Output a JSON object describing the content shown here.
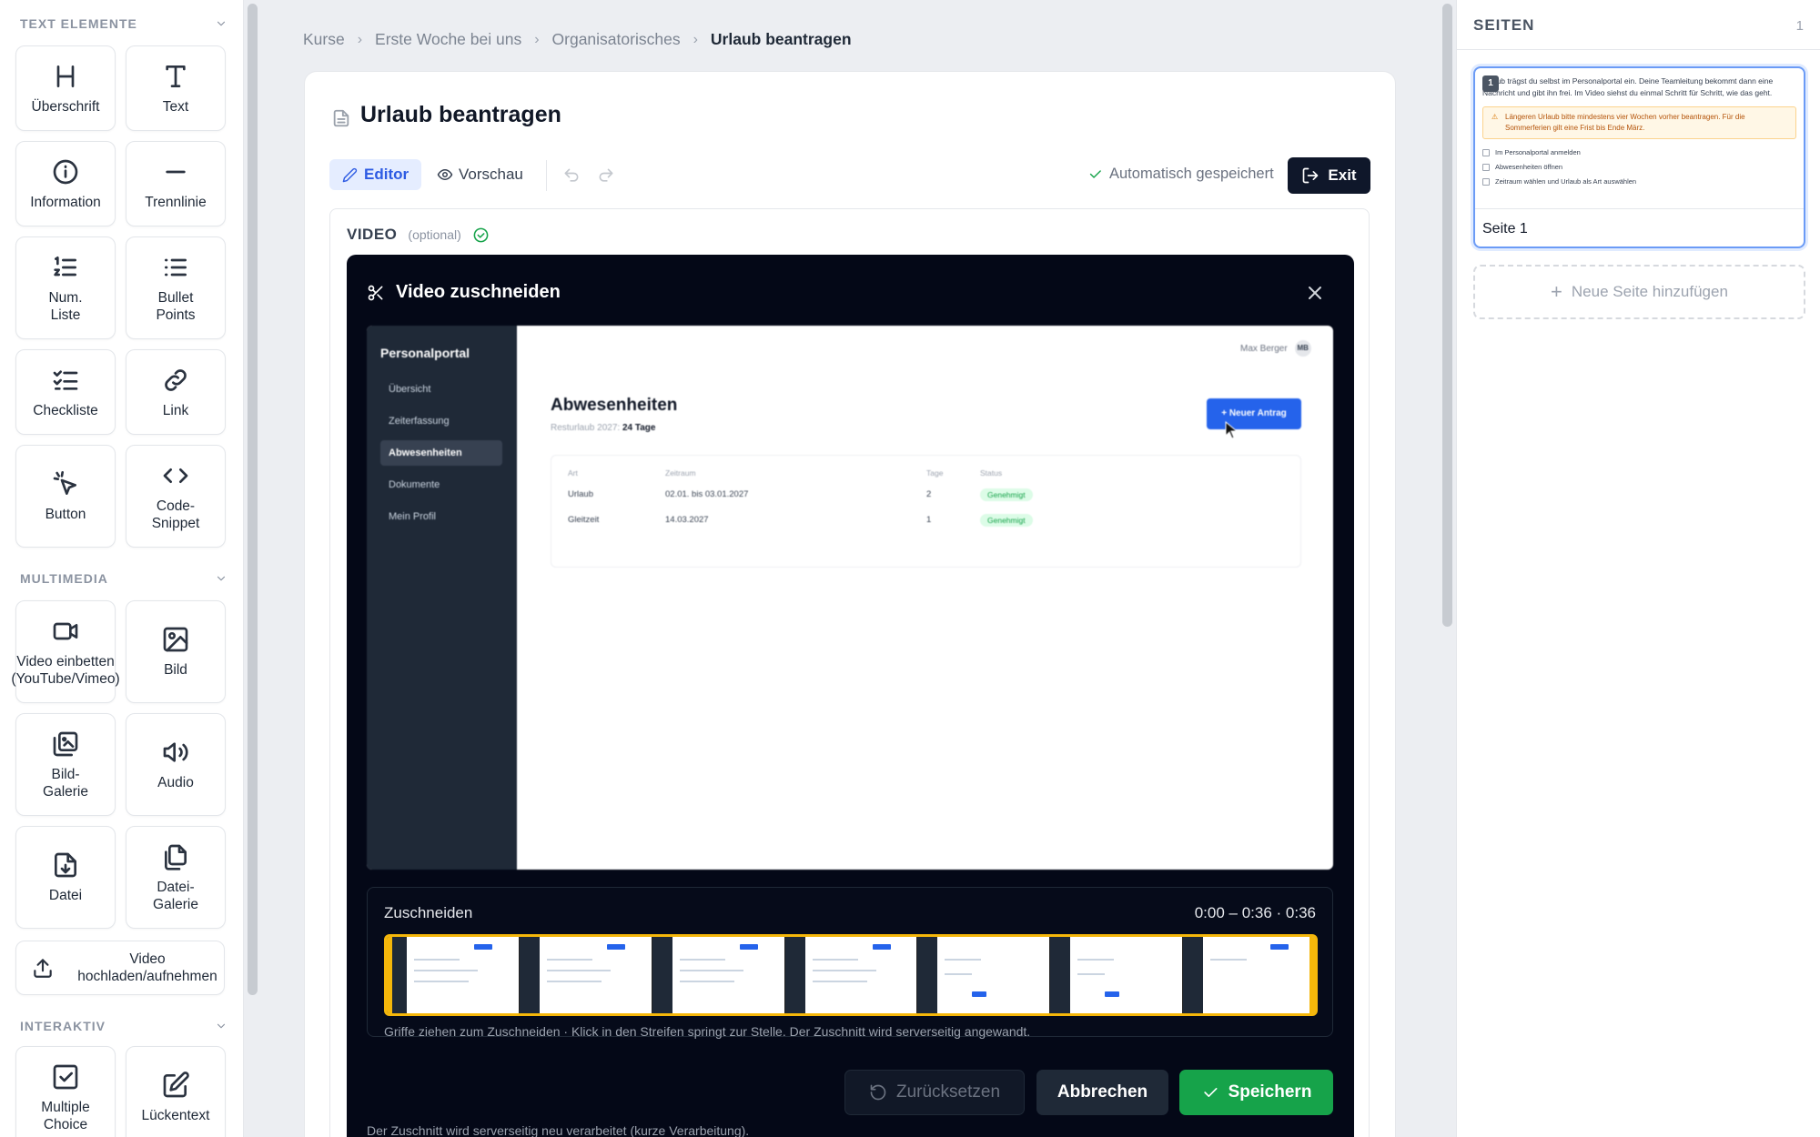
{
  "palette": {
    "sections": [
      {
        "title": "TEXT ELEMENTE"
      },
      {
        "title": "MULTIMEDIA"
      },
      {
        "title": "INTERAKTIV"
      }
    ],
    "text": [
      "Überschrift",
      "Text",
      "Information",
      "Trennlinie",
      "Num.\nListe",
      "Bullet\nPoints",
      "Checkliste",
      "Link",
      "Button",
      "Code-\nSnippet"
    ],
    "media": [
      "Video einbetten\n(YouTube/Vimeo)",
      "Bild",
      "Bild-\nGalerie",
      "Audio",
      "Datei",
      "Datei-\nGalerie"
    ],
    "upload": "Video\nhochladen/aufnehmen",
    "interactive": [
      "Multiple\nChoice",
      "Lückentext"
    ]
  },
  "breadcrumb": [
    "Kurse",
    "Erste Woche bei uns",
    "Organisatorisches",
    "Urlaub beantragen"
  ],
  "page": {
    "title": "Urlaub beantragen",
    "tab_editor": "Editor",
    "tab_preview": "Vorschau",
    "saved": "Automatisch gespeichert",
    "exit": "Exit"
  },
  "video": {
    "label": "VIDEO",
    "optional": "(optional)"
  },
  "modal": {
    "title": "Video zuschneiden",
    "trim_label": "Zuschneiden",
    "trim_time": "0:00 – 0:36 · 0:36",
    "hint": "Griffe ziehen zum Zuschneiden · Klick in den Streifen springt zur Stelle. Der Zuschnitt wird serverseitig angewandt.",
    "reset": "Zurücksetzen",
    "cancel": "Abbrechen",
    "save": "Speichern",
    "footer": "Der Zuschnitt wird serverseitig neu verarbeitet (kurze Verarbeitung)."
  },
  "preview": {
    "brand": "Personalportal",
    "nav": [
      "Übersicht",
      "Zeiterfassung",
      "Abwesenheiten",
      "Dokumente",
      "Mein Profil"
    ],
    "user": "Max Berger",
    "avatar": "MB",
    "heading": "Abwesenheiten",
    "sub_label": "Resturlaub 2027:",
    "sub_value": "24 Tage",
    "new_button": "+ Neuer Antrag",
    "columns": [
      "Art",
      "Zeitraum",
      "Tage",
      "Status"
    ],
    "rows": [
      [
        "Urlaub",
        "02.01. bis 03.01.2027",
        "2",
        "Genehmigt"
      ],
      [
        "Gleitzeit",
        "14.03.2027",
        "1",
        "Genehmigt"
      ]
    ]
  },
  "pages_panel": {
    "title": "SEITEN",
    "count": "1",
    "thumb_num": "1",
    "thumb_text": "Urlaub trägst du selbst im Personalportal ein. Deine Teamleitung bekommt dann eine Nachricht und gibt ihn frei. Im Video siehst du einmal Schritt für Schritt, wie das geht.",
    "thumb_warning": "Längeren Urlaub bitte mindestens vier Wochen vorher beantragen. Für die Sommerferien gilt eine Frist bis Ende März.",
    "thumb_checks": [
      "Im Personalportal anmelden",
      "Abwesenheiten öffnen",
      "Zeitraum wählen und Urlaub als Art auswählen"
    ],
    "page_name": "Seite 1",
    "add_page": "Neue Seite hinzufügen"
  },
  "colors": {
    "accent": "#2d5be3",
    "save_green": "#16a34a",
    "trim_yellow": "#f5b70a",
    "modal_bg": "#040817"
  }
}
